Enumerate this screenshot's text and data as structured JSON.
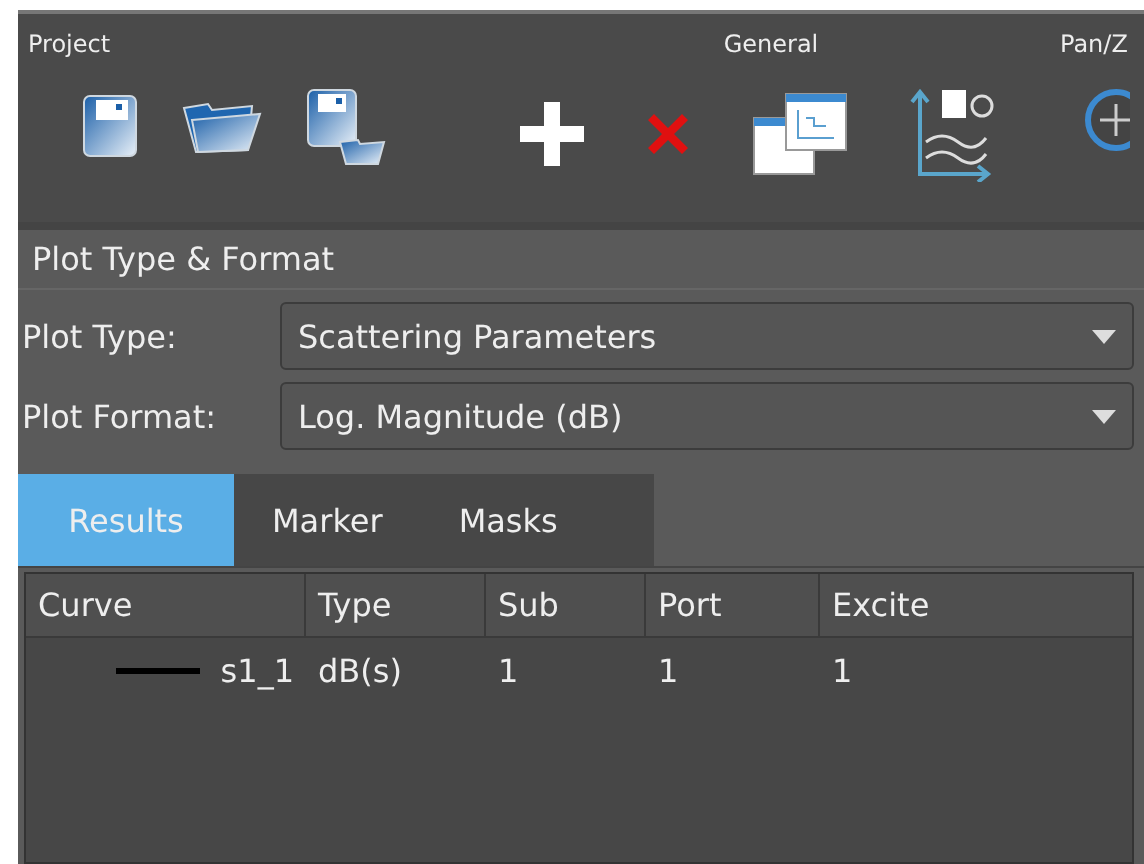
{
  "toolbar": {
    "groups": [
      {
        "label": "Project",
        "tools": [
          {
            "kind": "save"
          },
          {
            "kind": "open"
          },
          {
            "kind": "saveas"
          }
        ]
      },
      {
        "label": "General",
        "tools": [
          {
            "kind": "add"
          },
          {
            "kind": "delete"
          },
          {
            "kind": "windows"
          },
          {
            "kind": "refresh"
          }
        ]
      },
      {
        "label": "Pan/Z",
        "tools": [
          {
            "kind": "pan"
          }
        ]
      }
    ]
  },
  "section": {
    "title": "Plot Type & Format"
  },
  "fields": [
    {
      "label": "Plot Type:",
      "value": "Scattering Parameters"
    },
    {
      "label": "Plot Format:",
      "value": "Log. Magnitude (dB)"
    }
  ],
  "tabs": [
    {
      "label": "Results",
      "selected": true
    },
    {
      "label": "Marker",
      "selected": false
    },
    {
      "label": "Masks",
      "selected": false
    }
  ],
  "table": {
    "columns": [
      "Curve",
      "Type",
      "Sub",
      "Port",
      "Excite"
    ],
    "rows": [
      {
        "color": "#000000",
        "cells": [
          "s1_1",
          "dB(s)",
          "1",
          "1",
          "1"
        ]
      }
    ]
  }
}
